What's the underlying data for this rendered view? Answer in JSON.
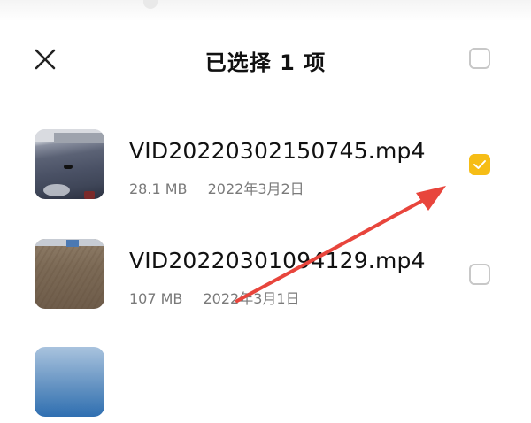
{
  "header": {
    "title": "已选择 1 项",
    "close_icon": "close-icon",
    "select_all_checked": false
  },
  "files": [
    {
      "name": "VID20220302150745.mp4",
      "size": "28.1 MB",
      "date": "2022年3月2日",
      "checked": true
    },
    {
      "name": "VID20220301094129.mp4",
      "size": "107 MB",
      "date": "2022年3月1日",
      "checked": false
    },
    {
      "name": "",
      "size": "",
      "date": "",
      "checked": false
    }
  ],
  "colors": {
    "checked": "#f6bd16",
    "annotation_arrow": "#e8453c",
    "secondary_text": "#7a7a7a"
  }
}
